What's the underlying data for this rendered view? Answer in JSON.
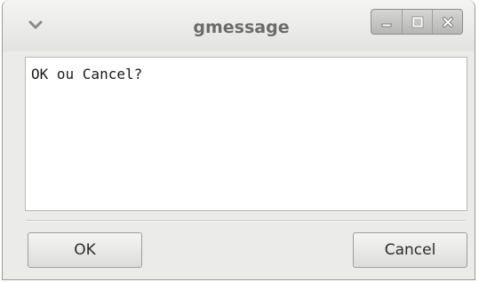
{
  "window": {
    "title": "gmessage",
    "menu_icon": "chevron-down-icon",
    "controls": [
      "minimize-icon",
      "maximize-icon",
      "close-icon"
    ]
  },
  "message": {
    "text": "OK ou Cancel?"
  },
  "buttons": {
    "ok_label": "OK",
    "cancel_label": "Cancel"
  },
  "colors": {
    "window_bg": "#ebebe9",
    "text_area_bg": "#ffffff",
    "title_text": "#6c6c6a"
  }
}
